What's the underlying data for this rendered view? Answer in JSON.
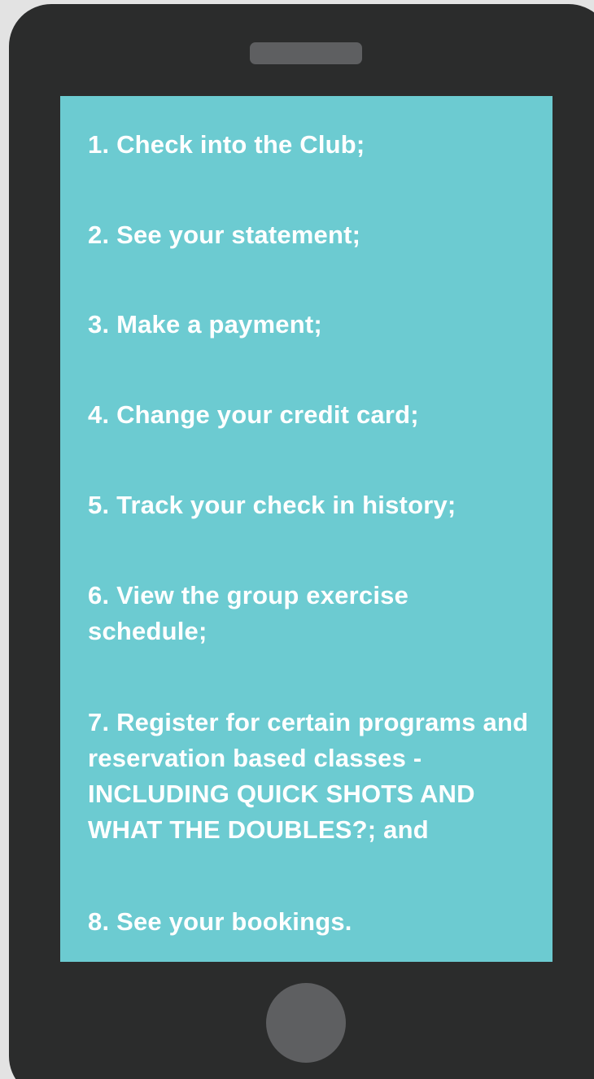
{
  "features": {
    "items": [
      "1. Check into the Club;",
      "2. See your statement;",
      "3. Make a payment;",
      "4. Change your credit card;",
      "5. Track your check in history;",
      "6. View the group exercise schedule;",
      "7. Register for certain programs and reservation based classes - INCLUDING QUICK SHOTS AND WHAT THE DOUBLES?; and",
      "8. See your bookings."
    ]
  },
  "colors": {
    "page_background": "#e3e3e3",
    "phone_body": "#2b2c2c",
    "phone_details": "#5e5f61",
    "screen_background": "#6ccbd1",
    "text": "#ffffff"
  },
  "icons": {
    "speaker": "speaker-grille-icon",
    "home": "home-button-icon"
  }
}
